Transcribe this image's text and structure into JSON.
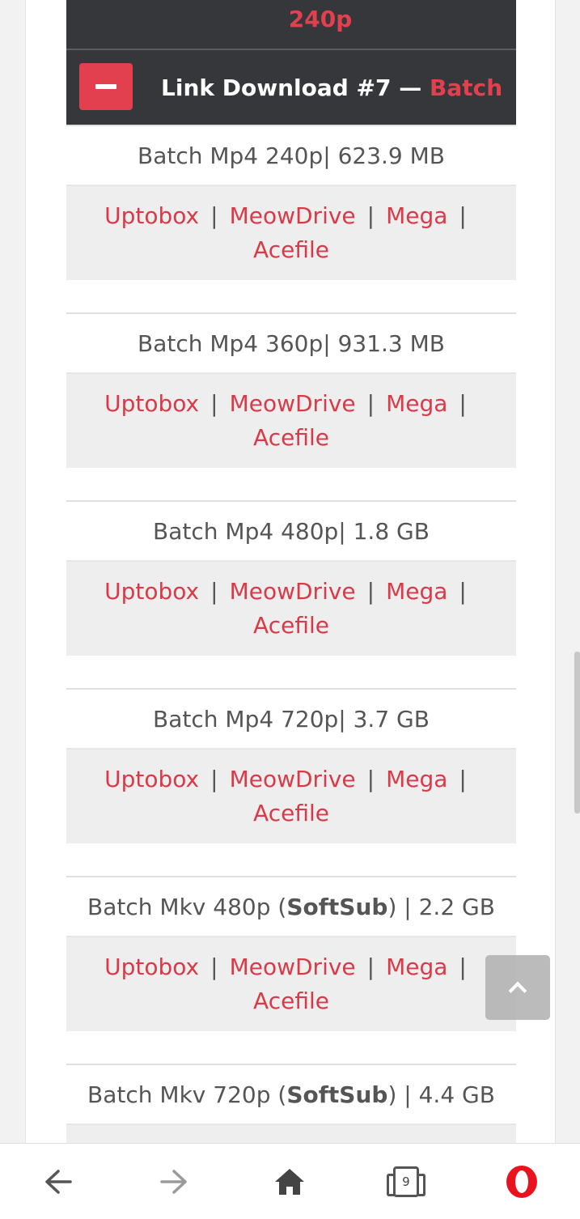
{
  "header": {
    "prev_title_tail": "240p",
    "title": "Link Download #7 —",
    "title_accent": "Batch"
  },
  "entries": [
    {
      "pre": "Batch Mp4 240p",
      "bold": "",
      "post": " | 623.9 MB"
    },
    {
      "pre": "Batch Mp4 360p",
      "bold": "",
      "post": " | 931.3 MB"
    },
    {
      "pre": "Batch Mp4 480p",
      "bold": "",
      "post": " | 1.8 GB"
    },
    {
      "pre": "Batch Mp4 720p",
      "bold": "",
      "post": " | 3.7 GB"
    },
    {
      "pre": "Batch Mkv 480p (",
      "bold": "SoftSub",
      "post": ") | 2.2 GB"
    },
    {
      "pre": "Batch Mkv 720p (",
      "bold": "SoftSub",
      "post": ") | 4.4 GB"
    }
  ],
  "links": {
    "uptobox": "Uptobox",
    "meowdrive": "MeowDrive",
    "mega": "Mega",
    "acefile": "Acefile",
    "separator": "|"
  },
  "navbar": {
    "tab_count": "9",
    "icons": [
      "back-arrow-icon",
      "forward-arrow-icon",
      "home-icon",
      "tabs-icon",
      "opera-logo-icon"
    ]
  },
  "colors": {
    "accent": "#e2404f",
    "link": "#d83a48",
    "header_bg": "#35373b",
    "links_bg": "#eeeeee"
  }
}
